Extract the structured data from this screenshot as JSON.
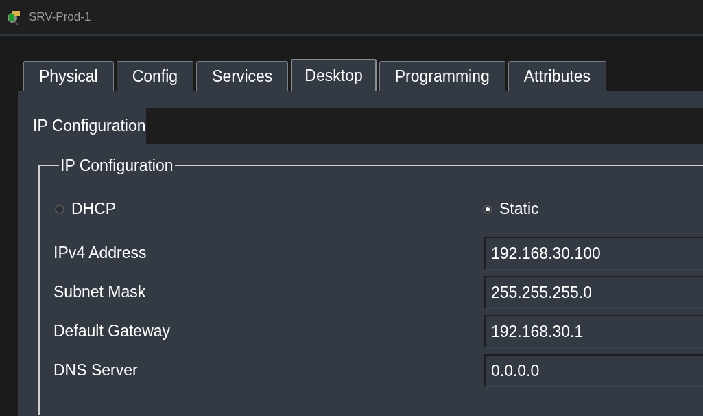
{
  "window": {
    "title": "SRV-Prod-1"
  },
  "tabs": [
    {
      "label": "Physical",
      "selected": false
    },
    {
      "label": "Config",
      "selected": false
    },
    {
      "label": "Services",
      "selected": false
    },
    {
      "label": "Desktop",
      "selected": true
    },
    {
      "label": "Programming",
      "selected": false
    },
    {
      "label": "Attributes",
      "selected": false
    }
  ],
  "app_title": "IP Configuration",
  "group": {
    "legend": "IP Configuration",
    "modes": [
      {
        "label": "DHCP",
        "selected": false
      },
      {
        "label": "Static",
        "selected": true
      }
    ],
    "fields": [
      {
        "label": "IPv4 Address",
        "value": "192.168.30.100"
      },
      {
        "label": "Subnet Mask",
        "value": "255.255.255.0"
      },
      {
        "label": "Default Gateway",
        "value": "192.168.30.1"
      },
      {
        "label": "DNS Server",
        "value": "0.0.0.0"
      }
    ]
  }
}
